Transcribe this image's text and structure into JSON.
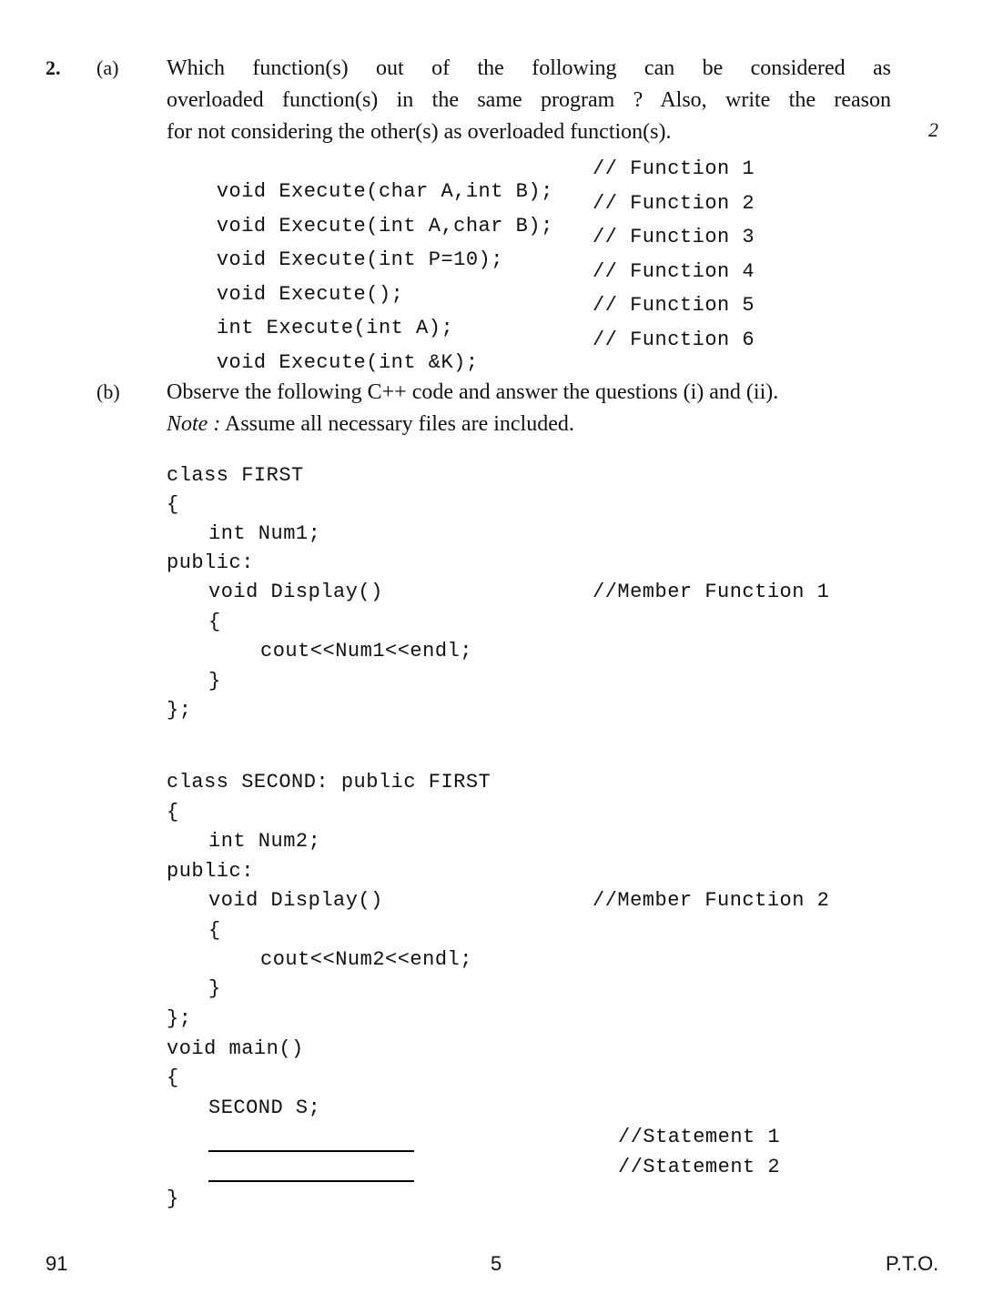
{
  "question": {
    "number": "2.",
    "marks": "2",
    "part_a": {
      "label": "(a)",
      "text_lines": [
        "Which function(s) out of the following can be considered as",
        "overloaded function(s) in the same program ? Also, write the reason",
        "for not considering the other(s) as overloaded function(s)."
      ],
      "functions": [
        {
          "code": "void Execute(char A,int B);",
          "comment": "// Function 1"
        },
        {
          "code": "void Execute(int A,char B);",
          "comment": "// Function 2"
        },
        {
          "code": "void Execute(int P=10);",
          "comment": "// Function 3"
        },
        {
          "code": "void Execute();",
          "comment": "// Function 4"
        },
        {
          "code": "int Execute(int A);",
          "comment": "// Function 5"
        },
        {
          "code": "void Execute(int &K);",
          "comment": "// Function 6"
        }
      ]
    },
    "part_b": {
      "label": "(b)",
      "intro": "Observe the following C++ code and answer the questions (i) and (ii).",
      "note_label": "Note :",
      "note_text": " Assume all necessary files are included.",
      "code_lines": [
        {
          "text": "class FIRST",
          "indent": 0,
          "comment": ""
        },
        {
          "text": "{",
          "indent": 0,
          "comment": ""
        },
        {
          "text": "int Num1;",
          "indent": 1,
          "comment": ""
        },
        {
          "text": "public:",
          "indent": 0,
          "comment": ""
        },
        {
          "text": "void Display()",
          "indent": 1,
          "comment": "//Member Function 1"
        },
        {
          "text": "{",
          "indent": 1,
          "comment": ""
        },
        {
          "text": "cout<<Num1<<endl;",
          "indent": 2,
          "comment": ""
        },
        {
          "text": "}",
          "indent": 1,
          "comment": ""
        },
        {
          "text": "};",
          "indent": 0,
          "comment": ""
        },
        {
          "text": "class SECOND: public FIRST",
          "indent": 0,
          "comment": ""
        },
        {
          "text": "{",
          "indent": 0,
          "comment": ""
        },
        {
          "text": "int Num2;",
          "indent": 1,
          "comment": ""
        },
        {
          "text": "public:",
          "indent": 0,
          "comment": ""
        },
        {
          "text": "void Display()",
          "indent": 1,
          "comment": "//Member Function 2"
        },
        {
          "text": "{",
          "indent": 1,
          "comment": ""
        },
        {
          "text": "cout<<Num2<<endl;",
          "indent": 2,
          "comment": ""
        },
        {
          "text": "}",
          "indent": 1,
          "comment": ""
        },
        {
          "text": "};",
          "indent": 0,
          "comment": ""
        },
        {
          "text": "void main()",
          "indent": 0,
          "comment": ""
        },
        {
          "text": "{",
          "indent": 0,
          "comment": ""
        },
        {
          "text": "SECOND S;",
          "indent": 1,
          "comment": ""
        },
        {
          "text": "}",
          "indent": 0,
          "comment": ""
        }
      ],
      "statement_comments": [
        "//Statement 1",
        "//Statement 2"
      ]
    }
  },
  "footer": {
    "code": "91",
    "page": "5",
    "pto": "P.T.O."
  }
}
